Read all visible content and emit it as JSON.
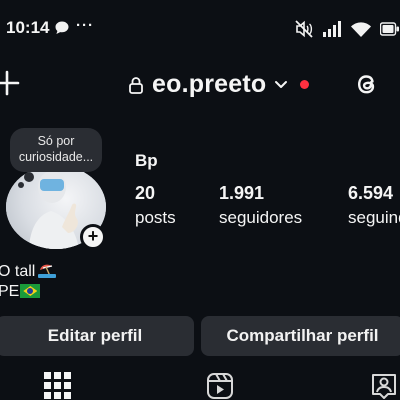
{
  "status_bar": {
    "time": "10:14",
    "dots": "···",
    "icons": [
      "chat-bubble-icon",
      "mute-icon",
      "signal-icon",
      "wifi-icon",
      "battery-icon"
    ]
  },
  "header": {
    "username": "eo.preeto",
    "icons": [
      "plus-icon",
      "lock-icon",
      "chevron-down-icon",
      "threads-icon"
    ],
    "notification_dot_color": "#ff3040"
  },
  "profile": {
    "note": "Só por curiosidade...",
    "display_name": "Bp",
    "stats": [
      {
        "count": "20",
        "label": "posts"
      },
      {
        "count": "1.991",
        "label": "seguidores"
      },
      {
        "count": "6.594",
        "label": "seguindo"
      }
    ],
    "bio_line1": "O tall",
    "bio_line2": "PE"
  },
  "buttons": {
    "edit": "Editar perfil",
    "share": "Compartilhar perfil"
  },
  "tabs": [
    "grid-icon",
    "reels-icon",
    "tagged-icon"
  ],
  "colors": {
    "background": "#0c0f14",
    "button_bg": "#2a2d33",
    "text": "#f5f5f5"
  }
}
